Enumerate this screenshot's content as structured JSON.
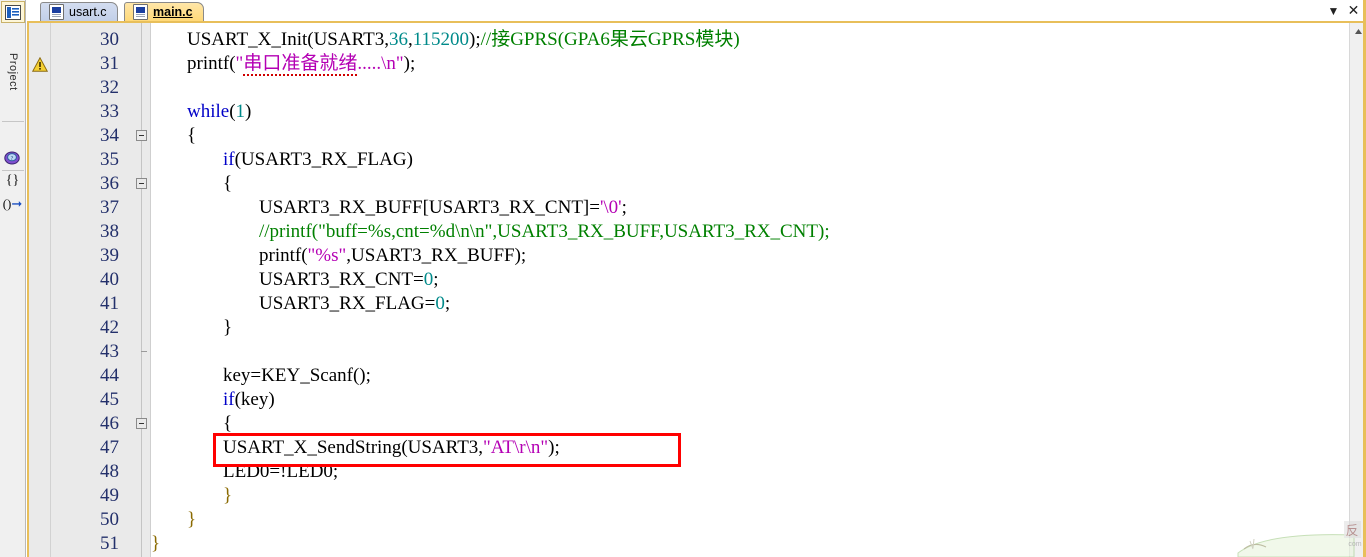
{
  "window": {
    "dropdown_glyph": "▼",
    "close_glyph": "✕"
  },
  "dock": {
    "label": "Project",
    "buttons": [
      {
        "name": "project-window-icon",
        "glyph": "▤"
      },
      {
        "name": "books-icon",
        "glyph": "◍"
      },
      {
        "name": "functions-icon",
        "glyph": "{}"
      },
      {
        "name": "templates-icon",
        "glyph": "0↦"
      }
    ]
  },
  "tabs": [
    {
      "label": "usart.c",
      "active": false
    },
    {
      "label": "main.c",
      "active": true
    }
  ],
  "editor": {
    "warning_marker_line": 31,
    "first_line": 30,
    "last_line": 51,
    "scroll_up_glyph": "▲",
    "lines": [
      {
        "num": 30,
        "indent": 1,
        "tokens": [
          {
            "t": "USART_X_Init(USART3,",
            "c": "plain"
          },
          {
            "t": "36",
            "c": "n"
          },
          {
            "t": ",",
            "c": "plain"
          },
          {
            "t": "115200",
            "c": "n"
          },
          {
            "t": ");",
            "c": "plain"
          },
          {
            "t": "//接GPRS(GPA6果云GPRS模块)",
            "c": "c"
          }
        ]
      },
      {
        "num": 31,
        "indent": 1,
        "tokens": [
          {
            "t": "printf(",
            "c": "plain"
          },
          {
            "t": "\"",
            "c": "s"
          },
          {
            "t": "串口准备就绪",
            "c": "s-squiggle"
          },
          {
            "t": ".....\\n\"",
            "c": "s"
          },
          {
            "t": ");",
            "c": "plain"
          }
        ]
      },
      {
        "num": 32,
        "indent": 0,
        "tokens": []
      },
      {
        "num": 33,
        "indent": 1,
        "tokens": [
          {
            "t": "while",
            "c": "k"
          },
          {
            "t": "(",
            "c": "plain"
          },
          {
            "t": "1",
            "c": "n"
          },
          {
            "t": ")",
            "c": "plain"
          }
        ]
      },
      {
        "num": 34,
        "indent": 1,
        "tokens": [
          {
            "t": "{",
            "c": "plain"
          }
        ]
      },
      {
        "num": 35,
        "indent": 2,
        "tokens": [
          {
            "t": "if",
            "c": "k"
          },
          {
            "t": "(USART3_RX_FLAG)",
            "c": "plain"
          }
        ]
      },
      {
        "num": 36,
        "indent": 2,
        "tokens": [
          {
            "t": "{",
            "c": "plain"
          }
        ]
      },
      {
        "num": 37,
        "indent": 3,
        "tokens": [
          {
            "t": "USART3_RX_BUFF[USART3_RX_CNT]=",
            "c": "plain"
          },
          {
            "t": "'\\0'",
            "c": "s"
          },
          {
            "t": ";",
            "c": "plain"
          }
        ]
      },
      {
        "num": 38,
        "indent": 3,
        "tokens": [
          {
            "t": "//printf(\"buff=%s,cnt=%d\\n\\n\",USART3_RX_BUFF,USART3_RX_CNT);",
            "c": "c"
          }
        ]
      },
      {
        "num": 39,
        "indent": 3,
        "tokens": [
          {
            "t": "printf(",
            "c": "plain"
          },
          {
            "t": "\"%s\"",
            "c": "s"
          },
          {
            "t": ",USART3_RX_BUFF);",
            "c": "plain"
          }
        ]
      },
      {
        "num": 40,
        "indent": 3,
        "tokens": [
          {
            "t": "USART3_RX_CNT=",
            "c": "plain"
          },
          {
            "t": "0",
            "c": "n"
          },
          {
            "t": ";",
            "c": "plain"
          }
        ]
      },
      {
        "num": 41,
        "indent": 3,
        "tokens": [
          {
            "t": "USART3_RX_FLAG=",
            "c": "plain"
          },
          {
            "t": "0",
            "c": "n"
          },
          {
            "t": ";",
            "c": "plain"
          }
        ]
      },
      {
        "num": 42,
        "indent": 2,
        "tokens": [
          {
            "t": "}",
            "c": "plain"
          }
        ]
      },
      {
        "num": 43,
        "indent": 0,
        "tokens": []
      },
      {
        "num": 44,
        "indent": 2,
        "tokens": [
          {
            "t": "key=KEY_Scanf();",
            "c": "plain"
          }
        ]
      },
      {
        "num": 45,
        "indent": 2,
        "tokens": [
          {
            "t": "if",
            "c": "k"
          },
          {
            "t": "(key)",
            "c": "plain"
          }
        ]
      },
      {
        "num": 46,
        "indent": 2,
        "tokens": [
          {
            "t": "{",
            "c": "plain"
          }
        ]
      },
      {
        "num": 47,
        "indent": 2,
        "tokens": [
          {
            "t": "USART_X_SendString(USART3,",
            "c": "plain"
          },
          {
            "t": "\"AT\\r\\n\"",
            "c": "s"
          },
          {
            "t": ");",
            "c": "plain"
          }
        ]
      },
      {
        "num": 48,
        "indent": 2,
        "tokens": [
          {
            "t": "LED0=!LED0;",
            "c": "plain"
          }
        ]
      },
      {
        "num": 49,
        "indent": 2,
        "tokens": [
          {
            "t": "}",
            "c": "b"
          }
        ]
      },
      {
        "num": 50,
        "indent": 1,
        "tokens": [
          {
            "t": "}",
            "c": "b"
          }
        ]
      },
      {
        "num": 51,
        "indent": 0,
        "tokens": [
          {
            "t": "}",
            "c": "b"
          }
        ]
      }
    ],
    "fold_markers": [
      {
        "line": 34,
        "type": "collapse-box"
      },
      {
        "line": 36,
        "type": "collapse-box"
      },
      {
        "line": 43,
        "type": "fold-end-tick"
      },
      {
        "line": 46,
        "type": "collapse-box"
      }
    ],
    "annotation": {
      "name": "red-highlight-box",
      "target_line": 47,
      "color": "#ff0000"
    }
  },
  "colors": {
    "keyword": "#0000c8",
    "number": "#008a8a",
    "string": "#b400b4",
    "comment": "#008000",
    "brace": "#8a6a00",
    "line_number": "#23306b",
    "gutter_bg": "#eaeaea",
    "tab_active_bg": "#ffd978",
    "tab_inactive_bg": "#c2cfe8",
    "frame_accent": "#e8bf5a"
  }
}
